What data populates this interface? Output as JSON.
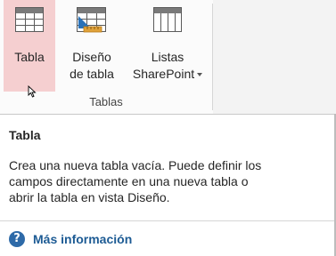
{
  "ribbon": {
    "buttons": [
      {
        "label_line1": "Tabla",
        "label_line2": "",
        "icon": "table-icon",
        "selected": true,
        "has_dropdown": false
      },
      {
        "label_line1": "Diseño",
        "label_line2": "de tabla",
        "icon": "table-design-icon",
        "selected": false,
        "has_dropdown": false
      },
      {
        "label_line1": "Listas",
        "label_line2": "SharePoint",
        "icon": "sharepoint-list-icon",
        "selected": false,
        "has_dropdown": true
      }
    ],
    "group_label": "Tablas"
  },
  "tooltip": {
    "title": "Tabla",
    "body_lines": [
      "Crea una nueva tabla vacía. Puede definir los",
      "campos directamente en una nueva tabla o",
      "abrir la tabla en vista Diseño."
    ],
    "more_info_label": "Más información",
    "more_info_icon": "help-icon"
  },
  "colors": {
    "selected_bg": "#f5cfd0",
    "link": "#1d5b94",
    "help_icon_bg": "#2e6aa8"
  }
}
